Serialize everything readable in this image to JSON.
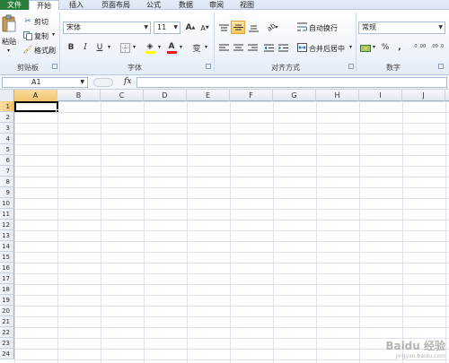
{
  "tabs": [
    "文件",
    "开始",
    "插入",
    "页面布局",
    "公式",
    "数据",
    "审阅",
    "视图"
  ],
  "clipboard": {
    "paste_label": "粘贴",
    "cut_label": "剪切",
    "copy_label": "复制",
    "format_painter_label": "格式刷",
    "group_title": "剪贴板"
  },
  "font": {
    "font_name": "宋体",
    "font_size": "11",
    "bold": "B",
    "italic": "I",
    "underline": "U",
    "grow": "A",
    "shrink": "A",
    "font_color_glyph": "A",
    "phonetic_glyph": "变",
    "group_title": "字体"
  },
  "alignment": {
    "wrap_label": "自动换行",
    "merge_label": "合并后居中",
    "group_title": "对齐方式"
  },
  "number": {
    "format_value": "常规",
    "percent": "%",
    "comma": ",",
    "inc_decimal": ".0 .00",
    "dec_decimal": ".00 .0",
    "group_title": "数字"
  },
  "formula_bar": {
    "name_box": "A1",
    "fx": "fx"
  },
  "columns": [
    "A",
    "B",
    "C",
    "D",
    "E",
    "F",
    "G",
    "H",
    "I",
    "J"
  ],
  "rows": [
    "1",
    "2",
    "3",
    "4",
    "5",
    "6",
    "7",
    "8",
    "9",
    "10",
    "11",
    "12",
    "13",
    "14",
    "15",
    "16",
    "17",
    "18",
    "19",
    "20",
    "21",
    "22",
    "23",
    "24"
  ],
  "active_cell": "A1",
  "watermark": {
    "main": "Baidu 经验",
    "sub": "jingyan.baidu.com"
  },
  "colors": {
    "file_tab": "#2d7d3a",
    "selection_header": "#f3c46c",
    "font_color_bar": "#e02020",
    "highlight_bar": "#ffff00"
  }
}
